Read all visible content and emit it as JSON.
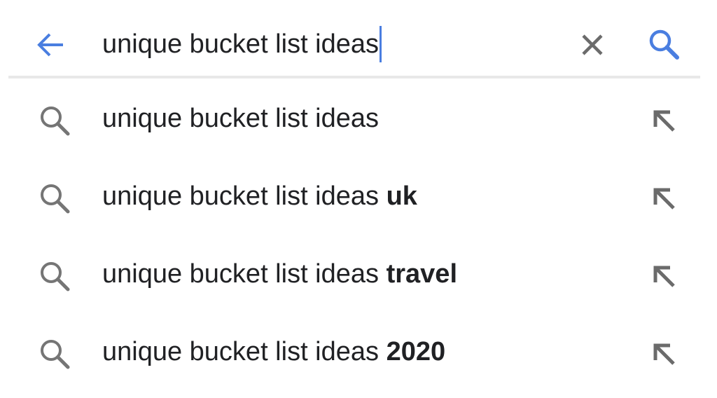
{
  "search": {
    "query": "unique bucket list ideas",
    "back_icon": "arrow-back-icon",
    "clear_icon": "close-icon",
    "submit_icon": "search-icon"
  },
  "suggestions": [
    {
      "base": "unique bucket list ideas",
      "completion": "",
      "icon": "search-icon",
      "action_icon": "arrow-up-left-icon"
    },
    {
      "base": "unique bucket list ideas ",
      "completion": "uk",
      "icon": "search-icon",
      "action_icon": "arrow-up-left-icon"
    },
    {
      "base": "unique bucket list ideas ",
      "completion": "travel",
      "icon": "search-icon",
      "action_icon": "arrow-up-left-icon"
    },
    {
      "base": "unique bucket list ideas ",
      "completion": "2020",
      "icon": "search-icon",
      "action_icon": "arrow-up-left-icon"
    }
  ],
  "colors": {
    "accent_blue": "#4a7ee0",
    "icon_gray": "#757575",
    "text": "#202124",
    "divider": "#e8e8e8"
  }
}
